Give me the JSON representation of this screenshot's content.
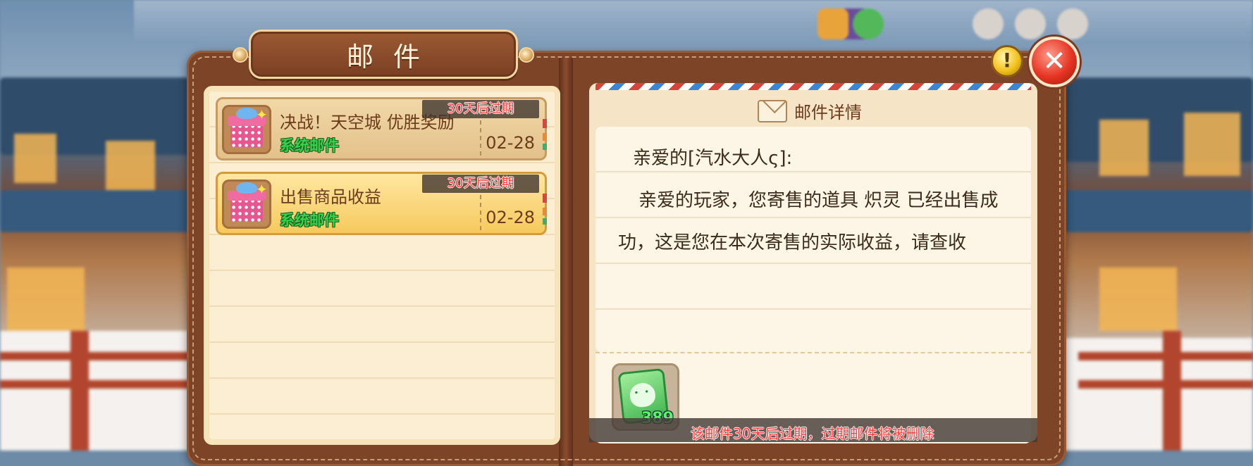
{
  "window": {
    "title": "邮件"
  },
  "mail_list": [
    {
      "subject": "决战！天空城 优胜奖励",
      "sender": "系统邮件",
      "date": "02-28",
      "expiry": "30天后过期",
      "selected": false
    },
    {
      "subject": "出售商品收益",
      "sender": "系统邮件",
      "date": "02-28",
      "expiry": "30天后过期",
      "selected": true
    }
  ],
  "detail": {
    "header": "邮件详情",
    "greeting": "亲爱的[汽水大人ς]:",
    "body_line1": "亲爱的玩家，您寄售的道具 炽灵 已经出售成",
    "body_line2": "功，这是您在本次寄售的实际收益，请查收",
    "attachment": {
      "icon": "green-gem-icon",
      "count": "389"
    },
    "expire_note": "该邮件30天后过期，过期邮件将被删除"
  },
  "buttons": {
    "warn": "!",
    "close": "✕"
  },
  "colors": {
    "panel": "#7d4427",
    "paper": "#fbeed2",
    "sender_green": "#39d14b",
    "expiry_red": "#ff3b3b"
  }
}
